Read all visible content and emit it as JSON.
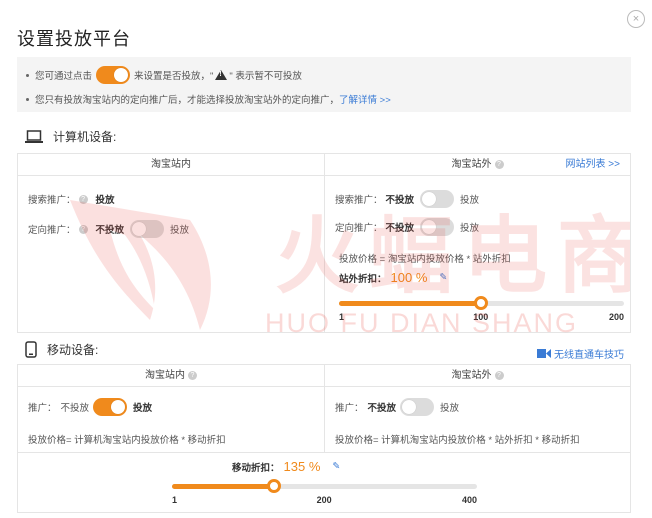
{
  "dialog": {
    "title": "设置投放平台",
    "close_glyph": "×"
  },
  "notice": {
    "line1_a": "您可通过点击",
    "line1_b": "来设置是否投放，\"",
    "line1_c": "\" 表示暂不可投放",
    "line2": "您只有投放淘宝站内的定向推广后，才能选择投放淘宝站外的定向推广，",
    "line2_link": "了解详情 >>"
  },
  "pc": {
    "heading": "计算机设备:",
    "inside": {
      "header": "淘宝站内",
      "search_label": "搜索推广：",
      "search_value": "投放",
      "target_label": "定向推广：",
      "target_off": "不投放",
      "target_on": "投放"
    },
    "outside": {
      "header": "淘宝站外",
      "site_list_link": "网站列表 >>",
      "search_label": "搜索推广：",
      "search_off": "不投放",
      "search_on": "投放",
      "target_label": "定向推广：",
      "target_off": "不投放",
      "target_on": "投放",
      "price_formula": "投放价格 = 淘宝站内投放价格 * 站外折扣",
      "discount_label": "站外折扣：",
      "discount_value": "100 %",
      "slider": {
        "min": 1,
        "max": 200,
        "mid_label": "100",
        "value": 100,
        "min_label": "1",
        "max_label": "200"
      }
    }
  },
  "mobile": {
    "heading": "移动设备:",
    "video_link": "无线直通车技巧",
    "inside": {
      "header": "淘宝站内",
      "promo_label": "推广：",
      "promo_off": "不投放",
      "promo_on": "投放",
      "price_formula": "投放价格= 计算机淘宝站内投放价格 * 移动折扣"
    },
    "outside": {
      "header": "淘宝站外",
      "promo_label": "推广：",
      "promo_off": "不投放",
      "promo_on": "投放",
      "price_formula": "投放价格= 计算机淘宝站内投放价格 * 站外折扣 * 移动折扣"
    },
    "discount_label": "移动折扣：",
    "discount_value": "135 %",
    "slider": {
      "min": 1,
      "max": 400,
      "value": 135,
      "min_label": "1",
      "mid_label": "200",
      "max_label": "400"
    }
  },
  "watermark": {
    "cn": "火蝠电商",
    "en": "HUO FU DIAN SHANG",
    "color": "#e8453c"
  },
  "colors": {
    "accent": "#f08a1c",
    "link": "#3a7bd5"
  }
}
